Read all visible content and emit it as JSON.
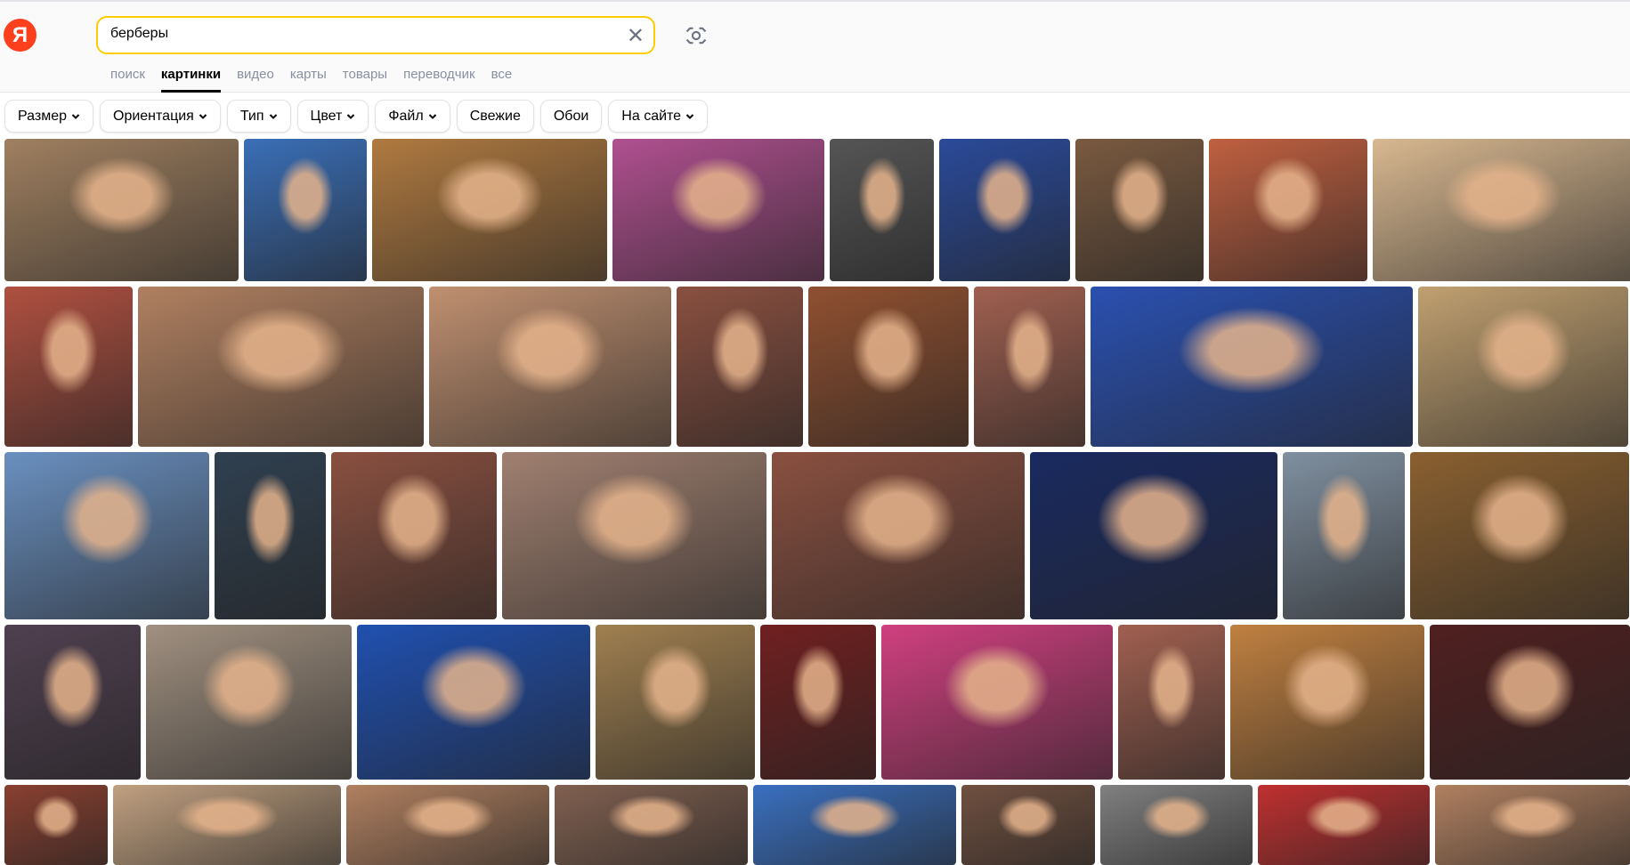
{
  "logo": "Я",
  "search": {
    "value": "берберы",
    "clear_icon": "close-icon",
    "camera_icon": "camera-icon"
  },
  "tabs": [
    {
      "label": "поиск"
    },
    {
      "label": "картинки",
      "active": true
    },
    {
      "label": "видео"
    },
    {
      "label": "карты"
    },
    {
      "label": "товары"
    },
    {
      "label": "переводчик"
    },
    {
      "label": "все"
    }
  ],
  "filters": [
    {
      "label": "Размер",
      "dropdown": true
    },
    {
      "label": "Ориентация",
      "dropdown": true
    },
    {
      "label": "Тип",
      "dropdown": true
    },
    {
      "label": "Цвет",
      "dropdown": true
    },
    {
      "label": "Файл",
      "dropdown": true
    },
    {
      "label": "Свежие",
      "dropdown": false
    },
    {
      "label": "Обои",
      "dropdown": false
    },
    {
      "label": "На сайте",
      "dropdown": true
    }
  ],
  "colors": {
    "accent": "#ffcc00",
    "logo": "#fc3f1d"
  },
  "image_rows": [
    [
      "#a08060",
      "#3a6fb8",
      "#b07a40",
      "#b05090",
      "#555555",
      "#2a4a9a",
      "#7a5a40",
      "#c06040",
      "#d8b890"
    ],
    [
      "#b05040",
      "#b08060",
      "#c09070",
      "#8a5040",
      "#905030",
      "#a06050",
      "#2a50b0",
      "#c0a070"
    ],
    [
      "#6a90c0",
      "#304050",
      "#8a5040",
      "#a08070",
      "#8a5040",
      "#1a2a60",
      "#8090a0",
      "#8a6030"
    ],
    [
      "#504050",
      "#a09080",
      "#2050b0",
      "#a08050",
      "#702020",
      "#d04080",
      "#a06050",
      "#c08040",
      "#502020"
    ],
    [
      "#8a4030",
      "#c0a080",
      "#b08060",
      "#806050",
      "#3a70c0",
      "#705040",
      "#808080",
      "#c03030",
      "#b08060"
    ]
  ]
}
